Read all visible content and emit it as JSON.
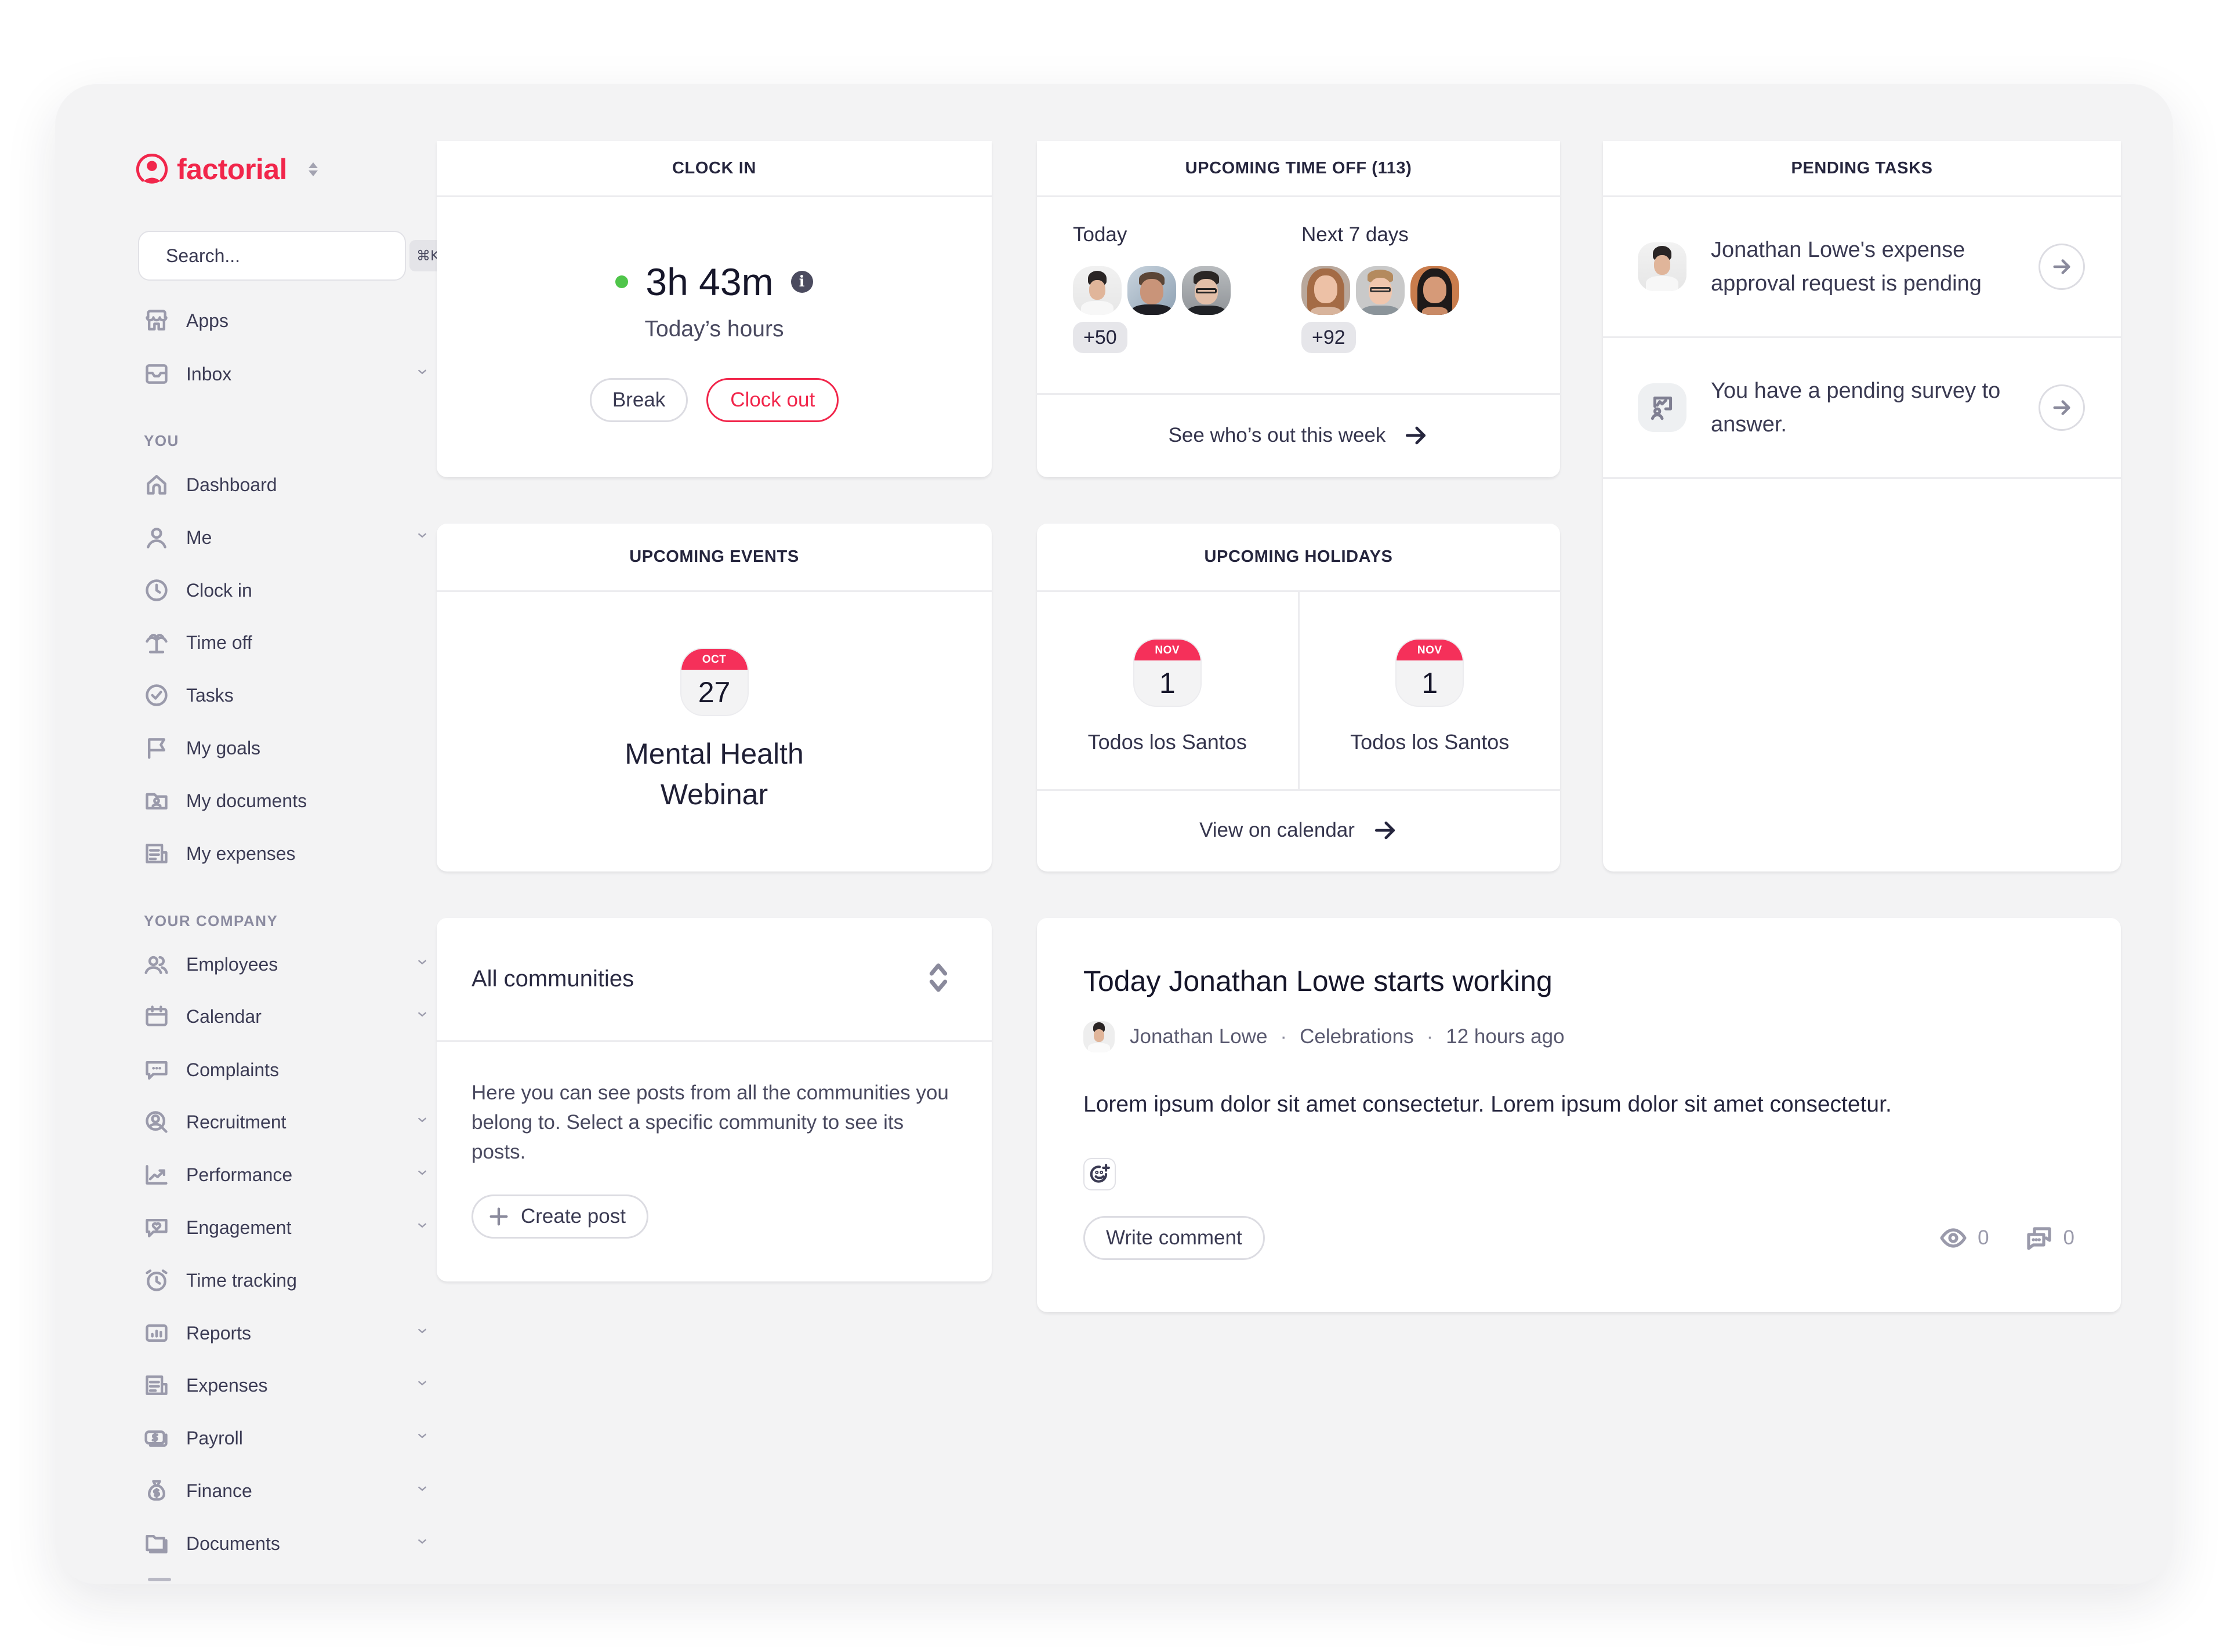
{
  "app": {
    "brand": "factorial",
    "accent_color": "#f1264b",
    "calendar_color": "#f5305a",
    "status_color": "#4fc54a"
  },
  "sidebar": {
    "search": {
      "placeholder": "Search...",
      "shortcut": "⌘K",
      "icon": "search-icon"
    },
    "top_items": [
      {
        "label": "Apps",
        "icon": "store-icon",
        "expandable": false
      },
      {
        "label": "Inbox",
        "icon": "inbox-icon",
        "expandable": true
      }
    ],
    "sections": [
      {
        "title": "YOU",
        "items": [
          {
            "label": "Dashboard",
            "icon": "home-icon",
            "expandable": false
          },
          {
            "label": "Me",
            "icon": "user-icon",
            "expandable": true
          },
          {
            "label": "Clock in",
            "icon": "clock-icon",
            "expandable": false
          },
          {
            "label": "Time off",
            "icon": "palm-tree-icon",
            "expandable": false
          },
          {
            "label": "Tasks",
            "icon": "check-circle-icon",
            "expandable": false
          },
          {
            "label": "My goals",
            "icon": "flag-icon",
            "expandable": false
          },
          {
            "label": "My documents",
            "icon": "user-folder-icon",
            "expandable": false
          },
          {
            "label": "My expenses",
            "icon": "receipt-icon",
            "expandable": false
          }
        ]
      },
      {
        "title": "YOUR COMPANY",
        "items": [
          {
            "label": "Employees",
            "icon": "users-icon",
            "expandable": true
          },
          {
            "label": "Calendar",
            "icon": "calendar-icon",
            "expandable": true
          },
          {
            "label": "Complaints",
            "icon": "chat-bubble-icon",
            "expandable": false
          },
          {
            "label": "Recruitment",
            "icon": "user-search-icon",
            "expandable": true
          },
          {
            "label": "Performance",
            "icon": "trend-chart-icon",
            "expandable": true
          },
          {
            "label": "Engagement",
            "icon": "heart-bubble-icon",
            "expandable": true
          },
          {
            "label": "Time tracking",
            "icon": "alarm-clock-icon",
            "expandable": false
          },
          {
            "label": "Reports",
            "icon": "bar-chart-icon",
            "expandable": true
          },
          {
            "label": "Expenses",
            "icon": "receipt-icon",
            "expandable": true
          },
          {
            "label": "Payroll",
            "icon": "money-icon",
            "expandable": true
          },
          {
            "label": "Finance",
            "icon": "money-bag-icon",
            "expandable": true
          },
          {
            "label": "Documents",
            "icon": "folder-icon",
            "expandable": true
          }
        ]
      }
    ]
  },
  "clock_in": {
    "title": "CLOCK IN",
    "status": "clocked-in",
    "time": "3h 43m",
    "subtitle": "Today’s hours",
    "break_label": "Break",
    "clock_out_label": "Clock out"
  },
  "time_off": {
    "title": "UPCOMING TIME OFF (113)",
    "today_label": "Today",
    "today_more": "+50",
    "next_label": "Next 7 days",
    "next_more": "+92",
    "link_label": "See who’s out this week"
  },
  "pending_tasks": {
    "title": "PENDING TASKS",
    "items": [
      {
        "text": "Jonathan Lowe's expense approval request is pending",
        "icon": "avatar"
      },
      {
        "text": "You have a pending survey to answer.",
        "icon": "survey-icon"
      }
    ]
  },
  "events": {
    "title": "UPCOMING EVENTS",
    "items": [
      {
        "month": "OCT",
        "day": "27",
        "name": "Mental Health Webinar"
      }
    ]
  },
  "holidays": {
    "title": "UPCOMING HOLIDAYS",
    "items": [
      {
        "month": "NOV",
        "day": "1",
        "name": "Todos los Santos"
      },
      {
        "month": "NOV",
        "day": "1",
        "name": "Todos los Santos"
      }
    ],
    "link_label": "View on calendar"
  },
  "communities": {
    "selected": "All communities",
    "description": "Here you can see posts from all the communities you belong to. Select a specific community to see its posts.",
    "create_label": "Create post"
  },
  "post": {
    "title": "Today Jonathan Lowe starts working",
    "author": "Jonathan Lowe",
    "community": "Celebrations",
    "time": "12 hours ago",
    "body": "Lorem ipsum dolor sit amet consectetur. Lorem ipsum dolor sit amet consectetur.",
    "comment_label": "Write comment",
    "views": "0",
    "comments": "0"
  }
}
